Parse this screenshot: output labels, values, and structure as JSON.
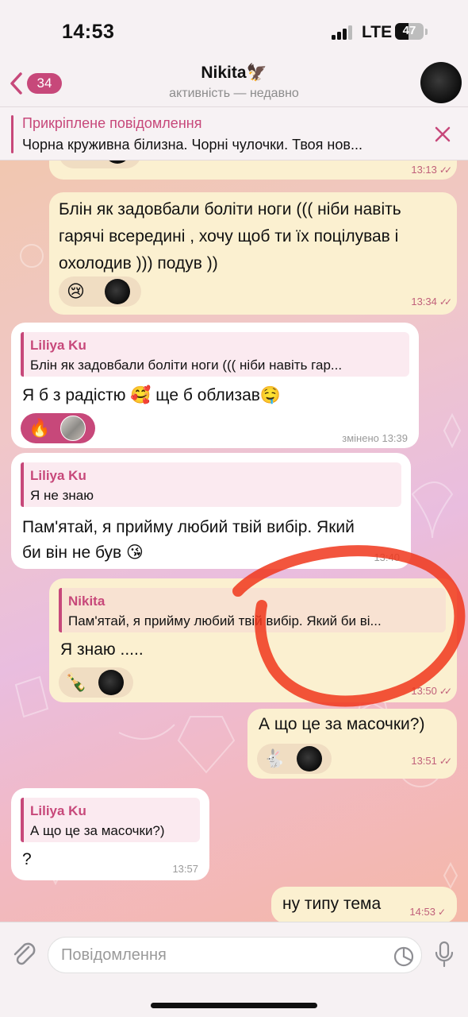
{
  "status_bar": {
    "time": "14:53",
    "network": "LTE",
    "battery": "47",
    "battery_fraction": 0.47
  },
  "header": {
    "back_count": "34",
    "title": "Nikita",
    "title_emoji": "🦅",
    "subtitle": "активність — недавно",
    "icons": {
      "back": "chevron-left-icon",
      "avatar": "avatar"
    }
  },
  "pinned": {
    "title": "Прикріплене повідомлення",
    "text": "Чорна круживна білизна. Чорні чулочки. Твоя нов...",
    "close_icon": "close-icon"
  },
  "messages": [
    {
      "time": "13:13",
      "reactions": [
        "🫣"
      ]
    },
    {
      "text_lines": [
        "Блін як задовбали боліти ноги ((( ніби навіть",
        "гарячі всередині , хочу щоб ти їх поцілував і",
        "охолодив ))) подув ))"
      ],
      "time": "13:34",
      "reactions": [
        "😢"
      ]
    },
    {
      "reply_name": "Liliya Ku",
      "reply_text": "Блін як задовбали боліти ноги ((( ніби навіть гар...",
      "text": "Я б з радістю 🥰 ще б облизав🤤",
      "time": "змінено 13:39",
      "reactions": [
        "🔥"
      ]
    },
    {
      "reply_name": "Liliya Ku",
      "reply_text": "Я не знаю",
      "text_lines": [
        "Пам'ятай, я прийму любий твій вибір. Який",
        "би він не був 😘"
      ],
      "time": "13:40"
    },
    {
      "reply_name": "Nikita",
      "reply_text": "Пам'ятай, я прийму любий твій вибір. Який би ві...",
      "text": "Я знаю .....",
      "time": "13:50",
      "reactions": [
        "🍾"
      ]
    },
    {
      "text": "А що це за масочки?)",
      "time": "13:51",
      "reactions": [
        "🐇"
      ]
    },
    {
      "reply_name": "Liliya Ku",
      "reply_text": "А що це за масочки?)",
      "text": "?",
      "time": "13:57"
    },
    {
      "text": "ну типу тема",
      "time": "14:53"
    }
  ],
  "input": {
    "placeholder": "Повідомлення",
    "icons": [
      "paperclip-icon",
      "sticker-icon",
      "microphone-icon"
    ]
  },
  "colors": {
    "accent": "#c7487a",
    "outgoing_bubble": "#fbf0d0",
    "incoming_bubble": "#ffffff",
    "annotation": "#f0371c"
  }
}
